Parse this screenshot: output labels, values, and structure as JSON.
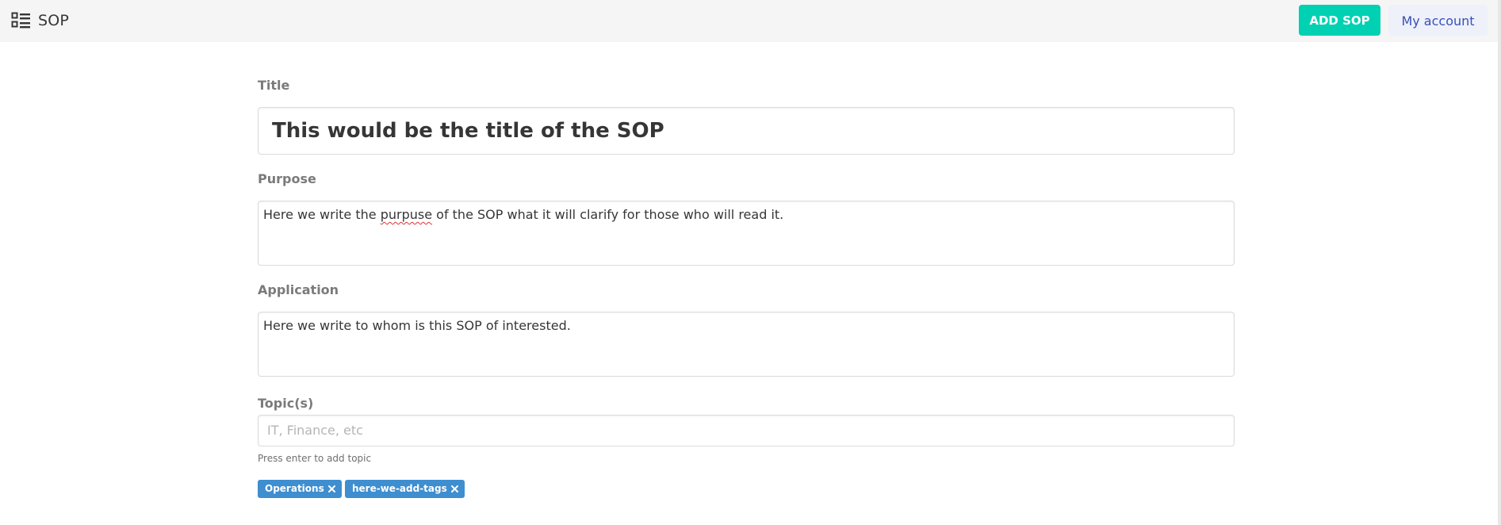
{
  "navbar": {
    "brand": "SOP",
    "brand_icon": "list-icon",
    "add_button": "ADD SOP",
    "account_button": "My account"
  },
  "form": {
    "title": {
      "label": "Title",
      "value": "This would be the title of the SOP"
    },
    "purpose": {
      "label": "Purpose",
      "value_before": "Here we write the ",
      "value_misspelled": "purpuse",
      "value_after": " of the SOP what it will clarify for those who will read it."
    },
    "application": {
      "label": "Application",
      "value": "Here we write to whom is this SOP of interested."
    },
    "topics": {
      "label": "Topic(s)",
      "placeholder": "IT, Finance, etc",
      "help": "Press enter to add topic",
      "tags": [
        {
          "label": "Operations"
        },
        {
          "label": "here-we-add-tags"
        }
      ]
    }
  },
  "colors": {
    "primary": "#00d1b2",
    "link": "#3850b7",
    "tag": "#3e8ed0",
    "navbar_bg": "#f5f5f5"
  }
}
